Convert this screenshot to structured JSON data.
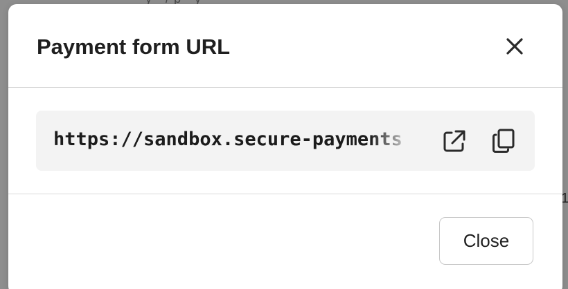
{
  "backdrop": {
    "top_fragment": "y   ·   /   p   ·   y",
    "right_fragment": "1"
  },
  "modal": {
    "title": "Payment form URL",
    "close_icon": "close-icon",
    "url": "https://sandbox.secure-payments",
    "open_icon": "external-link-icon",
    "copy_icon": "copy-icon",
    "close_button_label": "Close"
  }
}
